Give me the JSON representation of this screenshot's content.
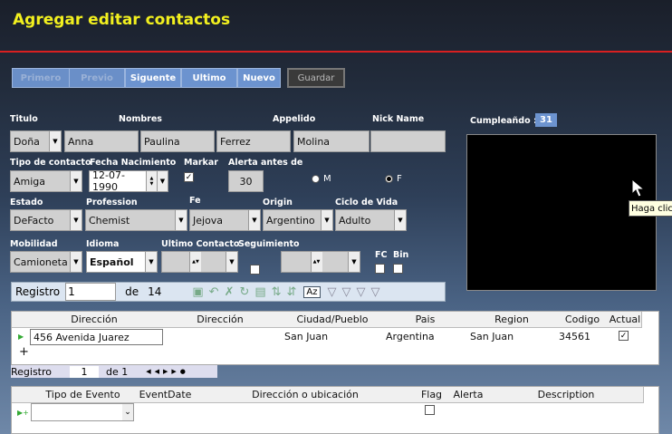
{
  "window": {
    "title": "Agregar editar contactos"
  },
  "nav": {
    "primero": "Primero",
    "previo": "Previo",
    "siguente": "Siguente",
    "ultimo": "Ultimo",
    "nuevo": "Nuevo",
    "guardar": "Guardar"
  },
  "labels": {
    "titulo": "Titulo",
    "nombres": "Nombres",
    "appelido": "Appelido",
    "nick": "Nick Name",
    "tipo": "Tipo de contacto",
    "fecha": "Fecha Nacimiento",
    "markar": "Markar",
    "alerta": "Alerta antes de",
    "m": "M",
    "f": "F",
    "estado": "Estado",
    "profession": "Profession",
    "fe": "Fe",
    "origin": "Origin",
    "ciclo": "Ciclo de Vida",
    "movilidad": "Mobilidad",
    "idioma": "Idioma",
    "ultimo_contacto": "Ultimo Contacto",
    "seguimiento": "Seguimiento",
    "fc": "FC",
    "bin": "Bin",
    "cumple": "Cumpleañdo :"
  },
  "values": {
    "titulo": "Doña",
    "nombre1": "Anna",
    "nombre2": "Paulina",
    "nombre3": "Ferrez",
    "appelido": "Molina",
    "nick": "",
    "tipo": "Amiga",
    "fecha": "12-07-1990",
    "alerta": "30",
    "estado": "DeFacto",
    "profession": "Chemist",
    "fe": "Jejova",
    "origin": "Argentino",
    "ciclo": "Adulto",
    "movilidad": "Camioneta",
    "idioma": "Español",
    "cumple": "31"
  },
  "tooltip": "Haga clic",
  "record_nav": {
    "label": "Registro",
    "current": "1",
    "of": "de",
    "total": "14"
  },
  "address_grid": {
    "headers": [
      "Dirección",
      "Dirección",
      "Ciudad/Pueblo",
      "Pais",
      "Region",
      "Codigo",
      "Actual"
    ],
    "row": [
      "456 Avenida Juarez",
      "",
      "San Juan",
      "Argentina",
      "San Juan",
      "34561",
      "✓"
    ],
    "nav": {
      "label": "Registro",
      "current": "1",
      "of": "de 1"
    }
  },
  "event_grid": {
    "headers": [
      "Tipo de Evento",
      "EventDate",
      "Dirección o ubicación",
      "Flag",
      "Alerta",
      "Description"
    ]
  }
}
